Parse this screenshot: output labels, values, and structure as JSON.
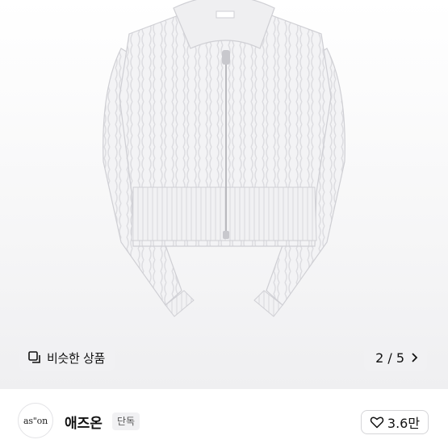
{
  "product": {
    "image_icon": "cable-knit-zip-cardigan-photo",
    "similar_button_label": "비슷한 상품",
    "similar_icon": "similar-items-icon",
    "pager_text": "2 / 5",
    "pager_icon": "chevron-right-icon"
  },
  "seller": {
    "avatar_text": "as\"on",
    "name": "애즈온",
    "badge": "단독",
    "like_icon": "heart-outline-icon",
    "like_count": "3.6만"
  }
}
